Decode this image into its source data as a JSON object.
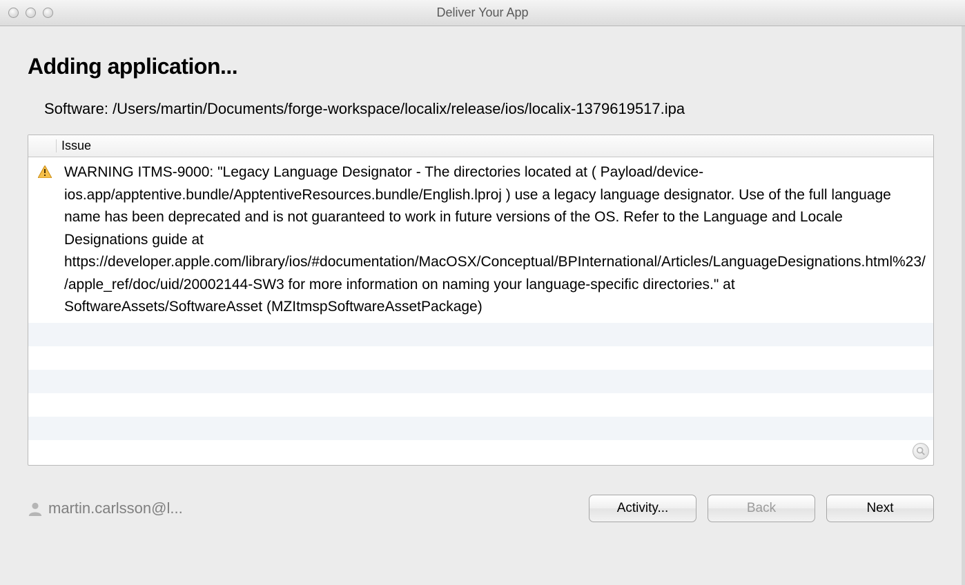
{
  "window": {
    "title": "Deliver Your App"
  },
  "page": {
    "heading": "Adding application...",
    "software_label": "Software:",
    "software_path": "/Users/martin/Documents/forge-workspace/localix/release/ios/localix-1379619517.ipa"
  },
  "issues": {
    "column_label": "Issue",
    "items": [
      {
        "severity": "warning",
        "text": "WARNING ITMS-9000: \"Legacy Language Designator - The directories located at ( Payload/device-ios.app/apptentive.bundle/ApptentiveResources.bundle/English.lproj ) use a legacy language designator. Use of the full language name has been deprecated and is not guaranteed to work in future versions of the OS. Refer to the Language and Locale Designations guide at https://developer.apple.com/library/ios/#documentation/MacOSX/Conceptual/BPInternational/Articles/LanguageDesignations.html%23//apple_ref/doc/uid/20002144-SW3 for more information on naming your language-specific directories.\" at SoftwareAssets/SoftwareAsset (MZItmspSoftwareAssetPackage)"
      }
    ]
  },
  "footer": {
    "user": "martin.carlsson@l...",
    "buttons": {
      "activity": "Activity...",
      "back": "Back",
      "next": "Next"
    }
  }
}
